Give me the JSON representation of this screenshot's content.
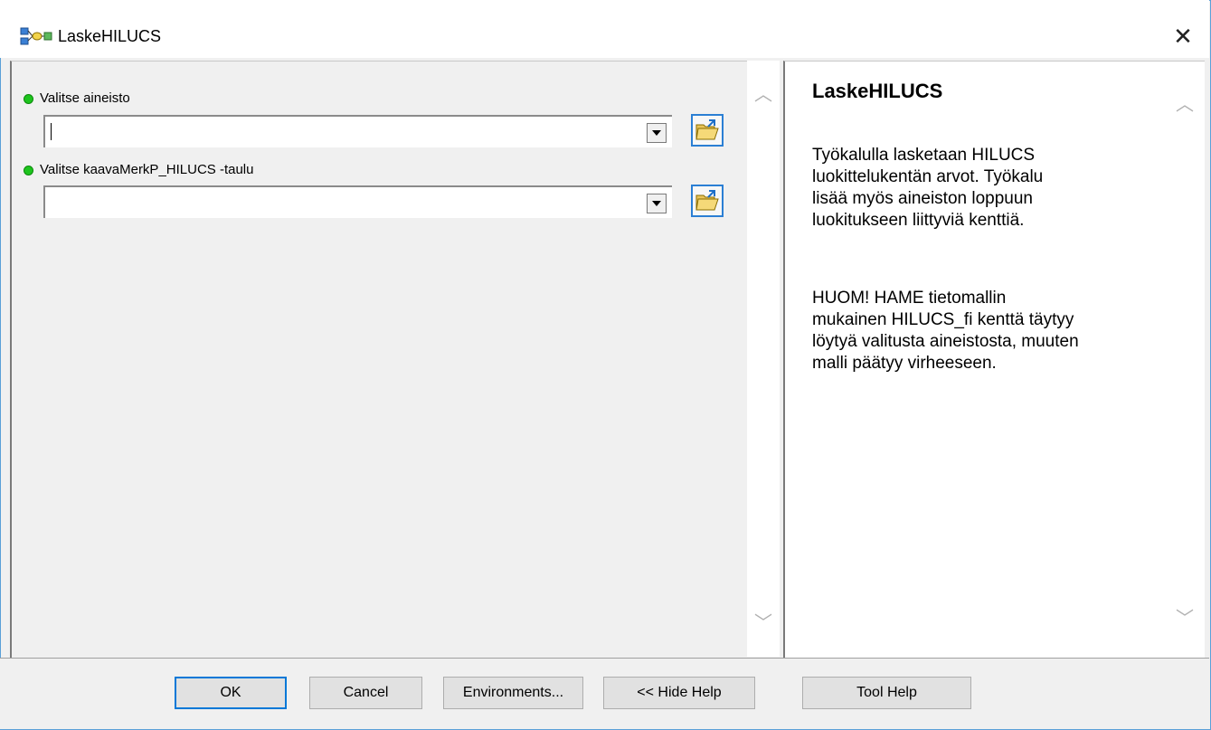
{
  "window": {
    "title": "LaskeHILUCS",
    "close_glyph": "✕"
  },
  "parameters": [
    {
      "label": "Valitse aineisto",
      "value": "",
      "icon": "green-dot-icon"
    },
    {
      "label": "Valitse kaavaMerkP_HILUCS -taulu",
      "value": "",
      "icon": "green-dot-icon"
    }
  ],
  "help": {
    "title": "LaskeHILUCS",
    "paragraph1": "Työkalulla lasketaan HILUCS\nluokittelukentän arvot. Työkalu\nlisää myös aineiston loppuun\nluokitukseen liittyviä kenttiä.",
    "paragraph2": "HUOM! HAME tietomallin\nmukainen HILUCS_fi kenttä täytyy\nlöytyä valitusta aineistosta, muuten\nmalli päätyy virheeseen."
  },
  "buttons": {
    "ok": "OK",
    "cancel": "Cancel",
    "environments": "Environments...",
    "hide_help": "<< Hide Help",
    "tool_help": "Tool Help"
  },
  "colors": {
    "accent": "#0078d7",
    "status_ok": "#1ec41e"
  }
}
